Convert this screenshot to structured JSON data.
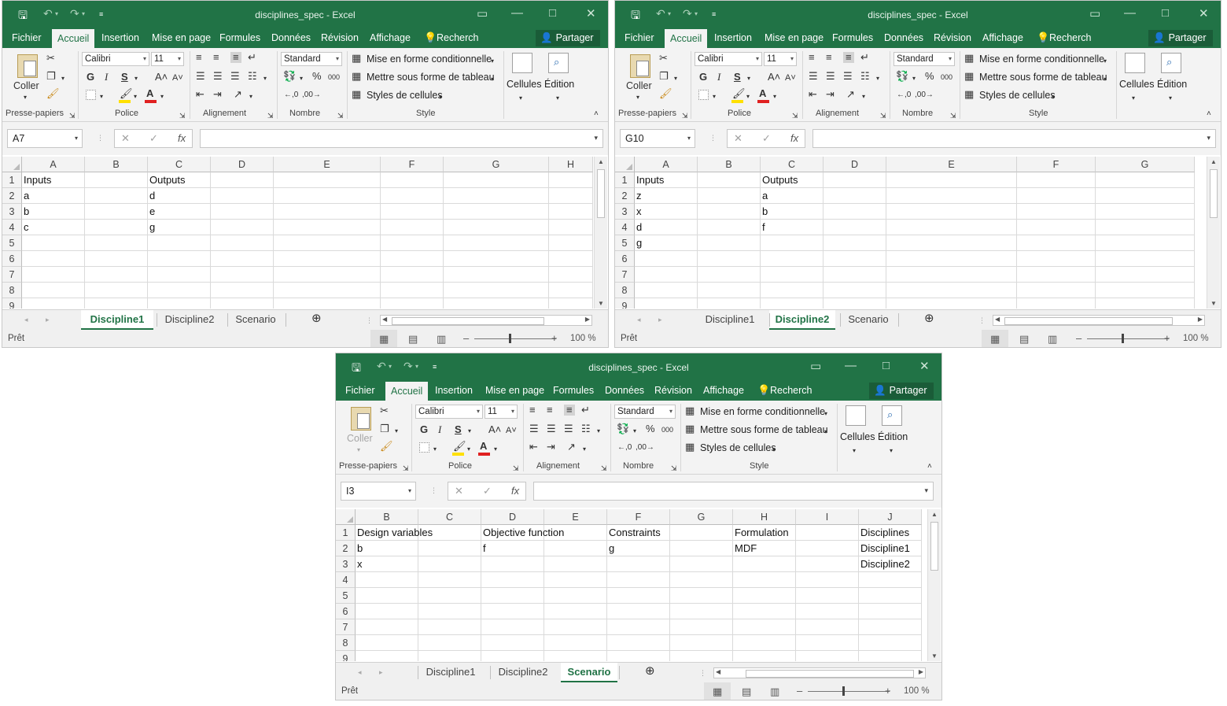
{
  "windows": [
    {
      "title": "disciplines_spec - Excel",
      "share_label": "Partager",
      "ribbon_tabs": [
        "Fichier",
        "Accueil",
        "Insertion",
        "Mise en page",
        "Formules",
        "Données",
        "Révision",
        "Affichage",
        "Recherch"
      ],
      "active_ribbon_tab": "Accueil",
      "paste_label": "Coller",
      "font_name": "Calibri",
      "font_size": "11",
      "number_format": "Standard",
      "cond_format_label": "Mise en forme conditionnelle",
      "table_format_label": "Mettre sous forme de tableau",
      "cell_styles_label": "Styles de cellules",
      "cells_label": "Cellules",
      "edit_label": "Édition",
      "groups": [
        "Presse-papiers",
        "Police",
        "Alignement",
        "Nombre",
        "Style"
      ],
      "name_box": "A7",
      "fx": "fx",
      "formula": "",
      "columns": [
        "A",
        "B",
        "C",
        "D",
        "E",
        "F",
        "G",
        "H"
      ],
      "rows": [
        "1",
        "2",
        "3",
        "4",
        "5",
        "6",
        "7",
        "8",
        "9"
      ],
      "cells": [
        [
          "Inputs",
          "",
          "Outputs",
          "",
          "",
          "",
          "",
          ""
        ],
        [
          "a",
          "",
          "d",
          "",
          "",
          "",
          "",
          ""
        ],
        [
          "b",
          "",
          "e",
          "",
          "",
          "",
          "",
          ""
        ],
        [
          "c",
          "",
          "g",
          "",
          "",
          "",
          "",
          ""
        ],
        [
          "",
          "",
          "",
          "",
          "",
          "",
          "",
          ""
        ],
        [
          "",
          "",
          "",
          "",
          "",
          "",
          "",
          ""
        ],
        [
          "",
          "",
          "",
          "",
          "",
          "",
          "",
          ""
        ],
        [
          "",
          "",
          "",
          "",
          "",
          "",
          "",
          ""
        ],
        [
          "",
          "",
          "",
          "",
          "",
          "",
          "",
          ""
        ]
      ],
      "sheets": [
        "Discipline1",
        "Discipline2",
        "Scenario"
      ],
      "active_sheet": "Discipline1",
      "status": "Prêt",
      "zoom": "100 %"
    },
    {
      "title": "disciplines_spec - Excel",
      "share_label": "Partager",
      "ribbon_tabs": [
        "Fichier",
        "Accueil",
        "Insertion",
        "Mise en page",
        "Formules",
        "Données",
        "Révision",
        "Affichage",
        "Recherch"
      ],
      "active_ribbon_tab": "Accueil",
      "paste_label": "Coller",
      "font_name": "Calibri",
      "font_size": "11",
      "number_format": "Standard",
      "cond_format_label": "Mise en forme conditionnelle",
      "table_format_label": "Mettre sous forme de tableau",
      "cell_styles_label": "Styles de cellules",
      "cells_label": "Cellules",
      "edit_label": "Édition",
      "groups": [
        "Presse-papiers",
        "Police",
        "Alignement",
        "Nombre",
        "Style"
      ],
      "name_box": "G10",
      "fx": "fx",
      "formula": "",
      "columns": [
        "A",
        "B",
        "C",
        "D",
        "E",
        "F",
        "G"
      ],
      "rows": [
        "1",
        "2",
        "3",
        "4",
        "5",
        "6",
        "7",
        "8",
        "9"
      ],
      "cells": [
        [
          "Inputs",
          "",
          "Outputs",
          "",
          "",
          "",
          ""
        ],
        [
          "z",
          "",
          "a",
          "",
          "",
          "",
          ""
        ],
        [
          "x",
          "",
          "b",
          "",
          "",
          "",
          ""
        ],
        [
          "d",
          "",
          "f",
          "",
          "",
          "",
          ""
        ],
        [
          "g",
          "",
          "",
          "",
          "",
          "",
          ""
        ],
        [
          "",
          "",
          "",
          "",
          "",
          "",
          ""
        ],
        [
          "",
          "",
          "",
          "",
          "",
          "",
          ""
        ],
        [
          "",
          "",
          "",
          "",
          "",
          "",
          ""
        ],
        [
          "",
          "",
          "",
          "",
          "",
          "",
          ""
        ]
      ],
      "sheets": [
        "Discipline1",
        "Discipline2",
        "Scenario"
      ],
      "active_sheet": "Discipline2",
      "status": "Prêt",
      "zoom": "100 %"
    },
    {
      "title": "disciplines_spec - Excel",
      "share_label": "Partager",
      "ribbon_tabs": [
        "Fichier",
        "Accueil",
        "Insertion",
        "Mise en page",
        "Formules",
        "Données",
        "Révision",
        "Affichage",
        "Recherch"
      ],
      "active_ribbon_tab": "Accueil",
      "paste_label": "Coller",
      "font_name": "Calibri",
      "font_size": "11",
      "number_format": "Standard",
      "cond_format_label": "Mise en forme conditionnelle",
      "table_format_label": "Mettre sous forme de tableau",
      "cell_styles_label": "Styles de cellules",
      "cells_label": "Cellules",
      "edit_label": "Édition",
      "groups": [
        "Presse-papiers",
        "Police",
        "Alignement",
        "Nombre",
        "Style"
      ],
      "name_box": "I3",
      "fx": "fx",
      "formula": "",
      "columns": [
        "B",
        "C",
        "D",
        "E",
        "F",
        "G",
        "H",
        "I",
        "J"
      ],
      "rows": [
        "1",
        "2",
        "3",
        "4",
        "5",
        "6",
        "7",
        "8",
        "9"
      ],
      "cells": [
        [
          "Design variables",
          "",
          "Objective function",
          "",
          "Constraints",
          "",
          "Formulation",
          "",
          "Disciplines"
        ],
        [
          "b",
          "",
          "f",
          "",
          "g",
          "",
          "MDF",
          "",
          "Discipline1"
        ],
        [
          "x",
          "",
          "",
          "",
          "",
          "",
          "",
          "",
          "Discipline2"
        ],
        [
          "",
          "",
          "",
          "",
          "",
          "",
          "",
          "",
          ""
        ],
        [
          "",
          "",
          "",
          "",
          "",
          "",
          "",
          "",
          ""
        ],
        [
          "",
          "",
          "",
          "",
          "",
          "",
          "",
          "",
          ""
        ],
        [
          "",
          "",
          "",
          "",
          "",
          "",
          "",
          "",
          ""
        ],
        [
          "",
          "",
          "",
          "",
          "",
          "",
          "",
          "",
          ""
        ],
        [
          "",
          "",
          "",
          "",
          "",
          "",
          "",
          "",
          ""
        ]
      ],
      "sheets": [
        "Discipline1",
        "Discipline2",
        "Scenario"
      ],
      "active_sheet": "Scenario",
      "status": "Prêt",
      "zoom": "100 %"
    }
  ],
  "colors": {
    "excel_green": "#217346",
    "ribbon_bg": "#f3f3f3",
    "grid_line": "#dadada",
    "font_color_bar": "#e02020",
    "highlight_bar": "#ffe000"
  }
}
